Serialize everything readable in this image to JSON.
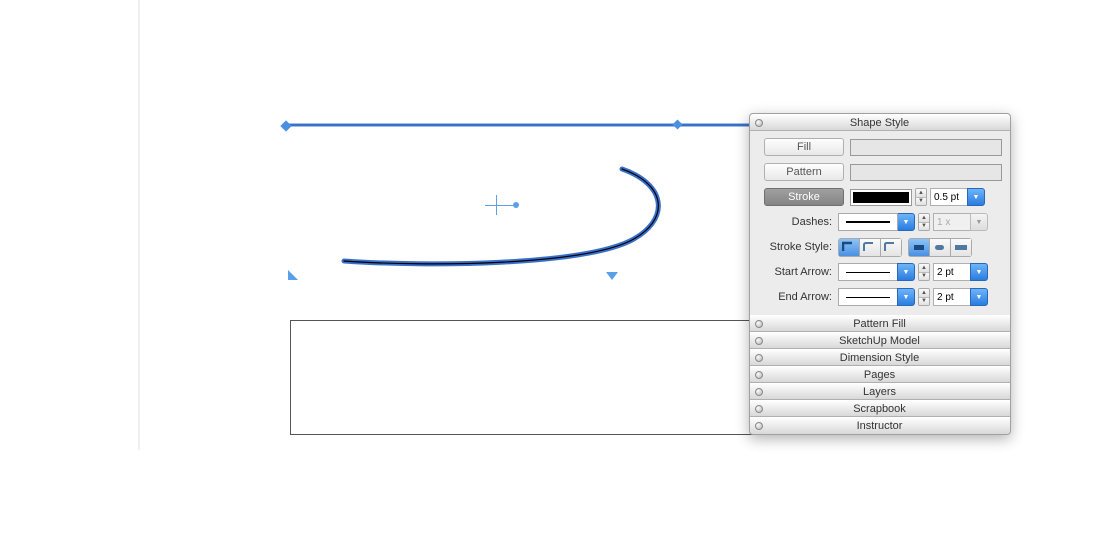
{
  "inspector": {
    "title": "Shape Style",
    "fill": {
      "label": "Fill"
    },
    "pattern": {
      "label": "Pattern"
    },
    "stroke": {
      "label": "Stroke",
      "weight": "0.5 pt"
    },
    "dashes": {
      "label": "Dashes:",
      "scale": "1 x"
    },
    "strokeStyle": {
      "label": "Stroke Style:"
    },
    "startArrow": {
      "label": "Start Arrow:",
      "size": "2 pt"
    },
    "endArrow": {
      "label": "End Arrow:",
      "size": "2 pt"
    },
    "collapsed": {
      "patternFill": "Pattern Fill",
      "sketchup": "SketchUp Model",
      "dimension": "Dimension Style",
      "pages": "Pages",
      "layers": "Layers",
      "scrapbook": "Scrapbook",
      "instructor": "Instructor"
    }
  }
}
